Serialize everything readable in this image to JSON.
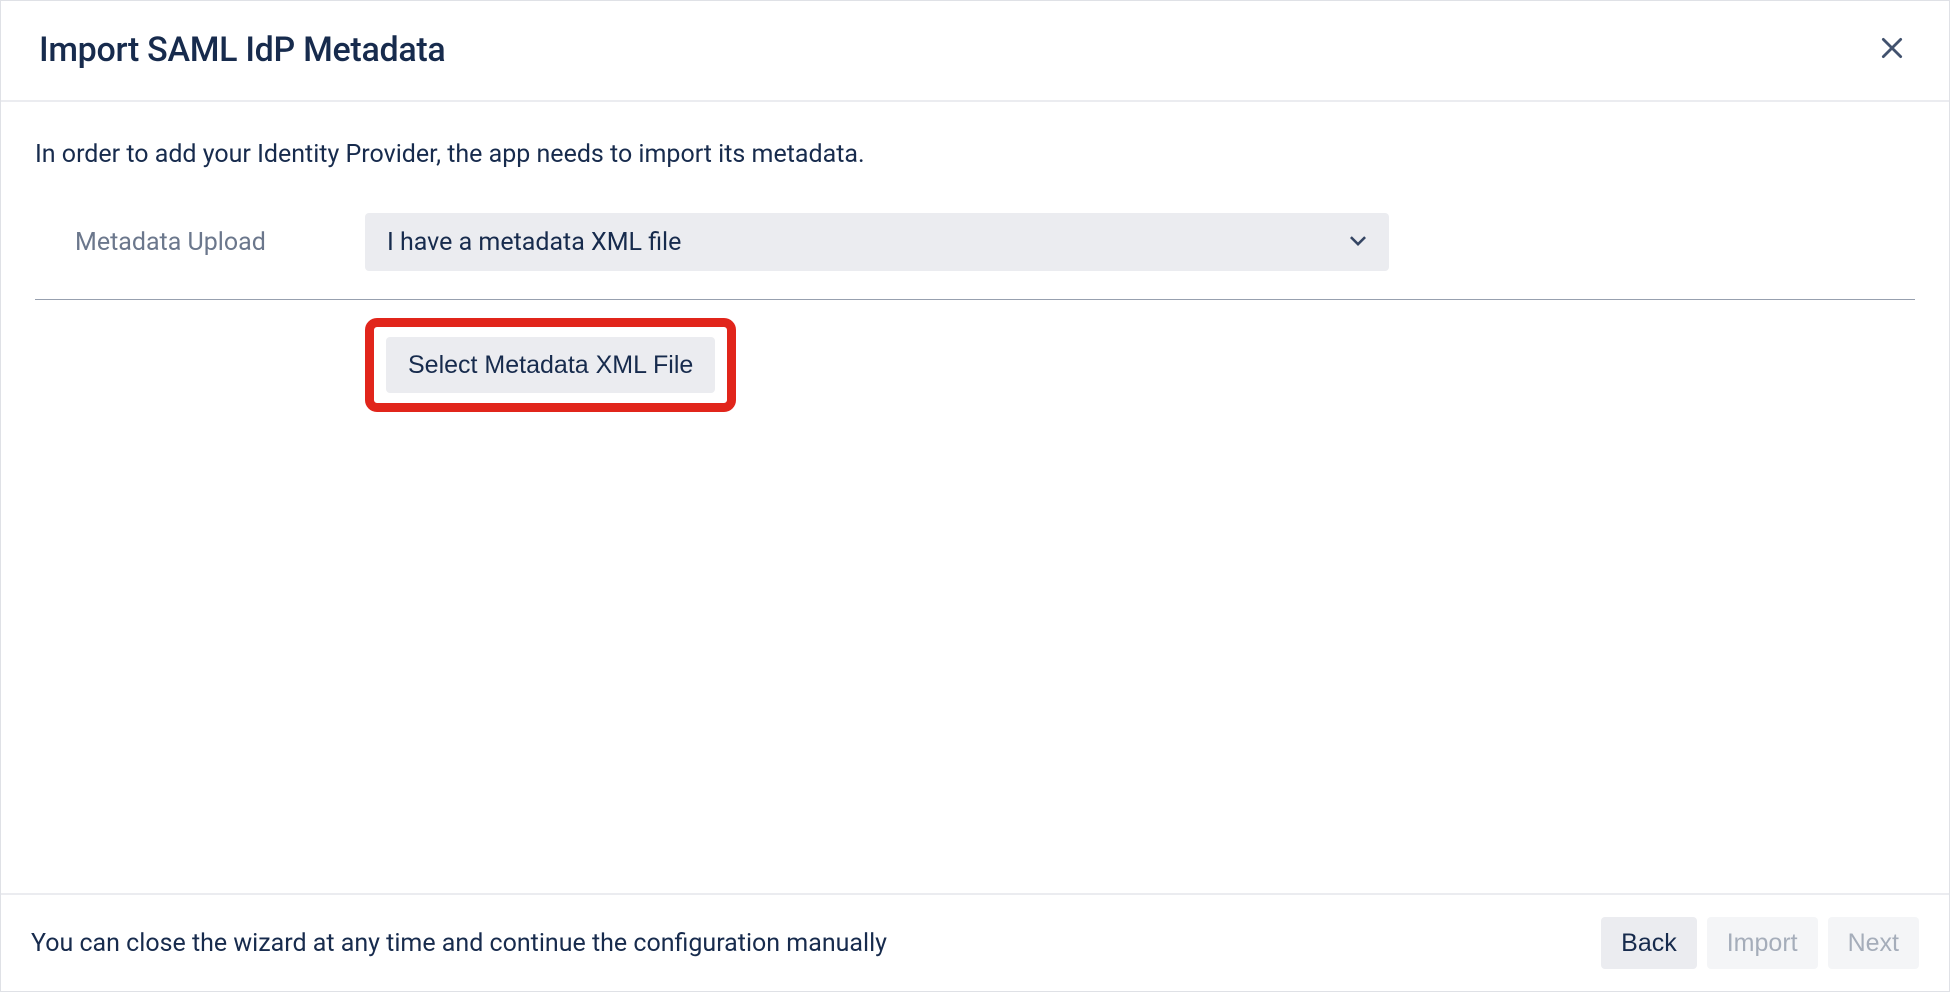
{
  "dialog": {
    "title": "Import SAML IdP Metadata",
    "instruction": "In order to add your Identity Provider, the app needs to import its metadata.",
    "form": {
      "upload_label": "Metadata Upload",
      "upload_value": "I have a metadata XML file",
      "file_button_label": "Select Metadata XML File"
    },
    "footer": {
      "hint": "You can close the wizard at any time and continue the configuration manually",
      "back_label": "Back",
      "import_label": "Import",
      "next_label": "Next"
    }
  }
}
